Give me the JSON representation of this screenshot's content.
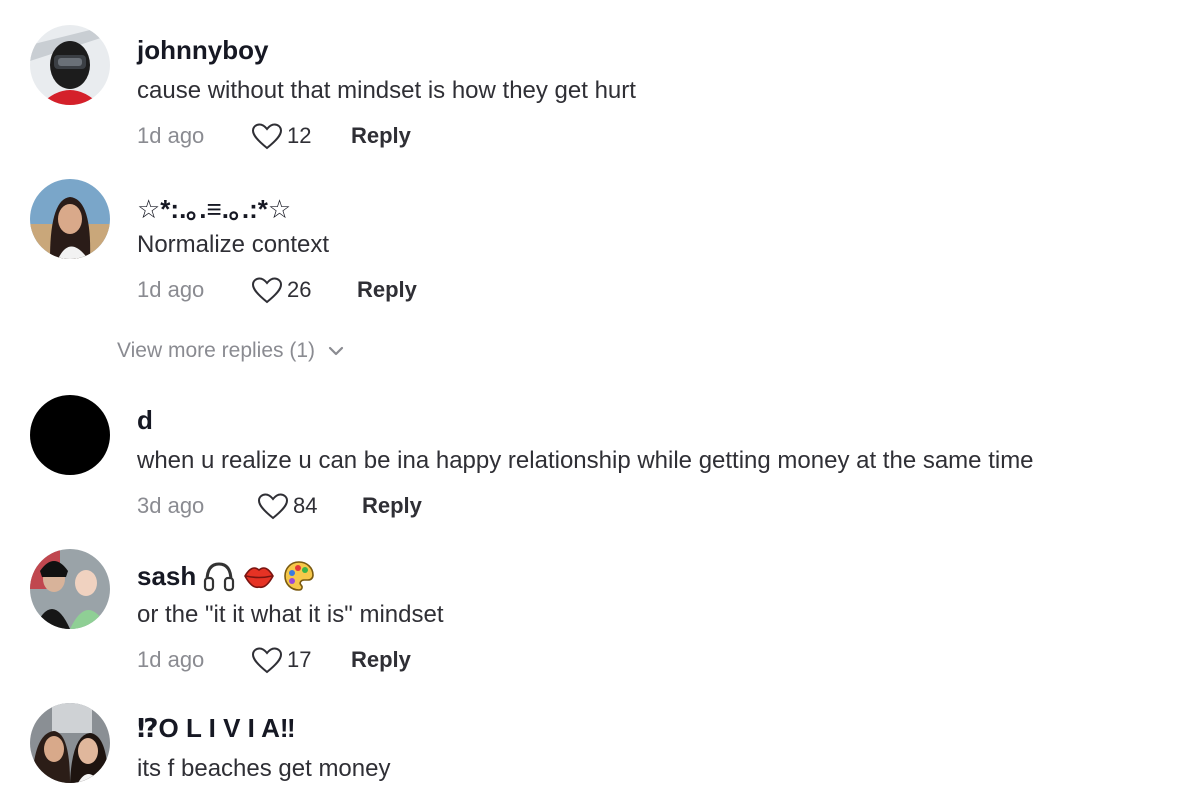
{
  "colors": {
    "username": "#161823",
    "text": "#2f2f35",
    "muted": "#8a8b91"
  },
  "comments": [
    {
      "username": "johnnyboy",
      "text": "cause without that mindset is how they get hurt",
      "time": "1d ago",
      "likes": "12",
      "reply_label": "Reply",
      "avatar": "helmet-avatar",
      "badges": []
    },
    {
      "username": "☆*:.｡.≡.｡.:*☆",
      "text": "Normalize context",
      "time": "1d ago",
      "likes": "26",
      "reply_label": "Reply",
      "avatar": "woman-avatar",
      "badges": []
    },
    {
      "username": "d",
      "text": "when u realize u can be ina happy relationship while getting money at the same time",
      "time": "3d ago",
      "likes": "84",
      "reply_label": "Reply",
      "avatar": "black-avatar",
      "badges": []
    },
    {
      "username": "sash",
      "text": "or the \"it it what it is\" mindset",
      "time": "1d ago",
      "likes": "17",
      "reply_label": "Reply",
      "avatar": "couple-avatar",
      "badges": [
        "headphones-emoji",
        "lips-emoji",
        "palette-emoji"
      ]
    },
    {
      "username": "⁉O L I V I A‼",
      "text": "its f beaches get money",
      "avatar": "friends-avatar",
      "badges": []
    }
  ],
  "view_more": {
    "label": "View more replies (1)",
    "icon": "chevron-down-icon"
  }
}
